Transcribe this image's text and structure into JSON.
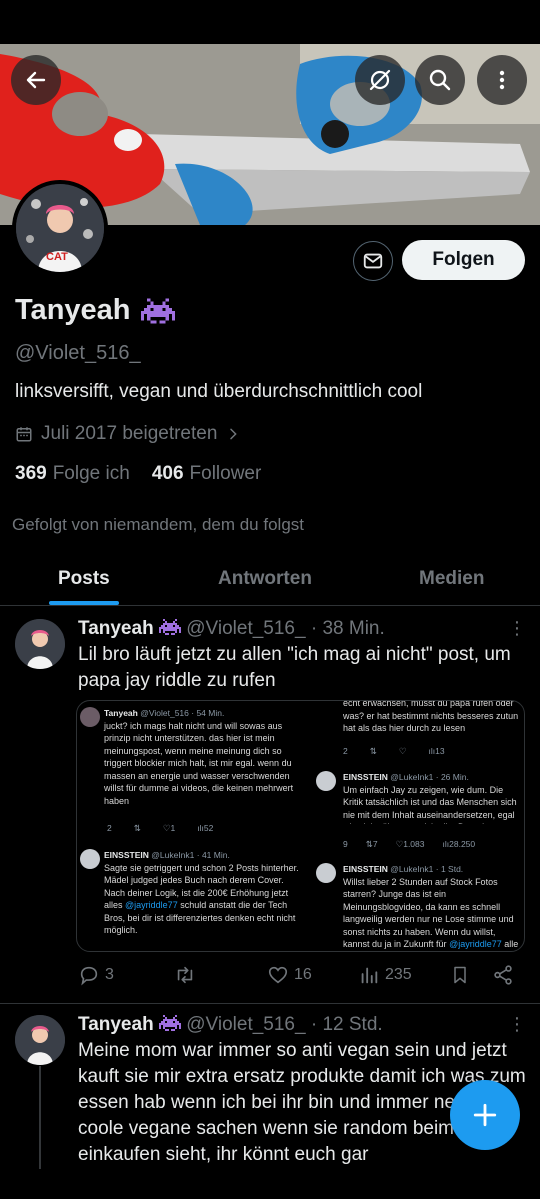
{
  "profile": {
    "name": "Tanyeah",
    "handle": "@Violet_516_",
    "bio": "linksversifft, vegan und überdurchschnittlich cool",
    "joined": "Juli 2017 beigetreten",
    "following_count": "369",
    "following_label": "Folge ich",
    "followers_count": "406",
    "followers_label": "Follower",
    "followed_by": "Gefolgt von niemandem, dem du folgst",
    "follow_button": "Folgen"
  },
  "tabs": [
    {
      "label": "Posts",
      "active": true
    },
    {
      "label": "Antworten",
      "active": false
    },
    {
      "label": "Medien",
      "active": false
    }
  ],
  "posts": [
    {
      "name": "Tanyeah",
      "handle": "@Violet_516_",
      "time": "· 38 Min.",
      "text": "Lil bro läuft jetzt zu allen \"ich mag ai nicht\" post, um papa jay riddle zu rufen",
      "replies": "3",
      "reposts": "",
      "likes": "16",
      "views": "235",
      "embedded": {
        "left_tweets": [
          {
            "name": "Tanyeah",
            "handle": "@Violet_516",
            "time": "· 54 Min.",
            "text": "juckt? ich mags halt nicht und will sowas aus prinzip nicht unterstützen. das hier ist mein meinungspost, wenn meine meinung dich so triggert blockier mich halt, ist mir egal. wenn du massen an energie und wasser verschwenden willst für dumme ai videos, die keinen mehrwert haben",
            "stats": [
              "2",
              "",
              "1",
              "52"
            ]
          },
          {
            "name": "EINSSTEIN",
            "handle": "@LukeInk1",
            "time": "· 41 Min.",
            "text_before": "Sagte sie getriggert und schon 2 Posts hinterher. Mädel judged jedes Buch nach derem Cover. Nach deiner Logik, ist die 200€ Erhöhung jetzt alles",
            "mention": "@jayriddle77",
            "text_after": "schuld anstatt die der Tech Bros, bei dir ist differenziertes denken echt nicht möglich."
          }
        ],
        "right_tweets": [
          {
            "text": "echt erwachsen, musst du papa rufen oder was? er hat bestimmt nichts besseres zutun hat als das hier durch zu lesen",
            "stats": [
              "2",
              "",
              "",
              "13"
            ]
          },
          {
            "name": "EINSSTEIN",
            "handle": "@LukeInk1",
            "time": "· 26 Min.",
            "text": "Um einfach Jay zu zeigen, wie dum. Die Kritik tatsächlich ist und das Menschen sich nie mit dem Inhalt auseinandersetzen, egal wie viel mühe man sich gibt. Du gehst",
            "stats": [
              "9",
              "7",
              "1.083",
              "28.250"
            ]
          },
          {
            "name": "EINSSTEIN",
            "handle": "@LukeInk1",
            "time": "· 1 Std.",
            "text_before": "Willst lieber 2 Stunden auf Stock Fotos starren? Junge das ist ein Meinungsblogvideo, da kann es schnell langweilig werden nur ne Lose stimme und sonst nichts zu haben. Wenn du willst, kannst du ja in Zukunft für",
            "mention": "@jayriddle77",
            "text_after": "alle Szenen animieren, trottel"
          }
        ]
      }
    },
    {
      "name": "Tanyeah",
      "handle": "@Violet_516_",
      "time": "· 12 Std.",
      "text": "Meine mom war immer so anti vegan sein und jetzt kauft sie mir extra ersatz produkte damit ich was zum essen hab wenn ich bei ihr bin und immer neue coole vegane sachen wenn sie random beim einkaufen sieht, ihr könnt euch gar"
    }
  ],
  "colors": {
    "accent": "#1d9bf0",
    "background": "#000000",
    "text": "#e7e9ea",
    "muted": "#71767b",
    "badge": "#a070e0"
  },
  "icons": [
    "back-arrow-icon",
    "shuffle-icon",
    "search-icon",
    "more-vertical-icon",
    "mail-icon",
    "alien-icon",
    "calendar-icon",
    "chevron-right-icon",
    "reply-icon",
    "repost-icon",
    "like-icon",
    "views-icon",
    "bookmark-icon",
    "share-icon",
    "plus-icon"
  ]
}
